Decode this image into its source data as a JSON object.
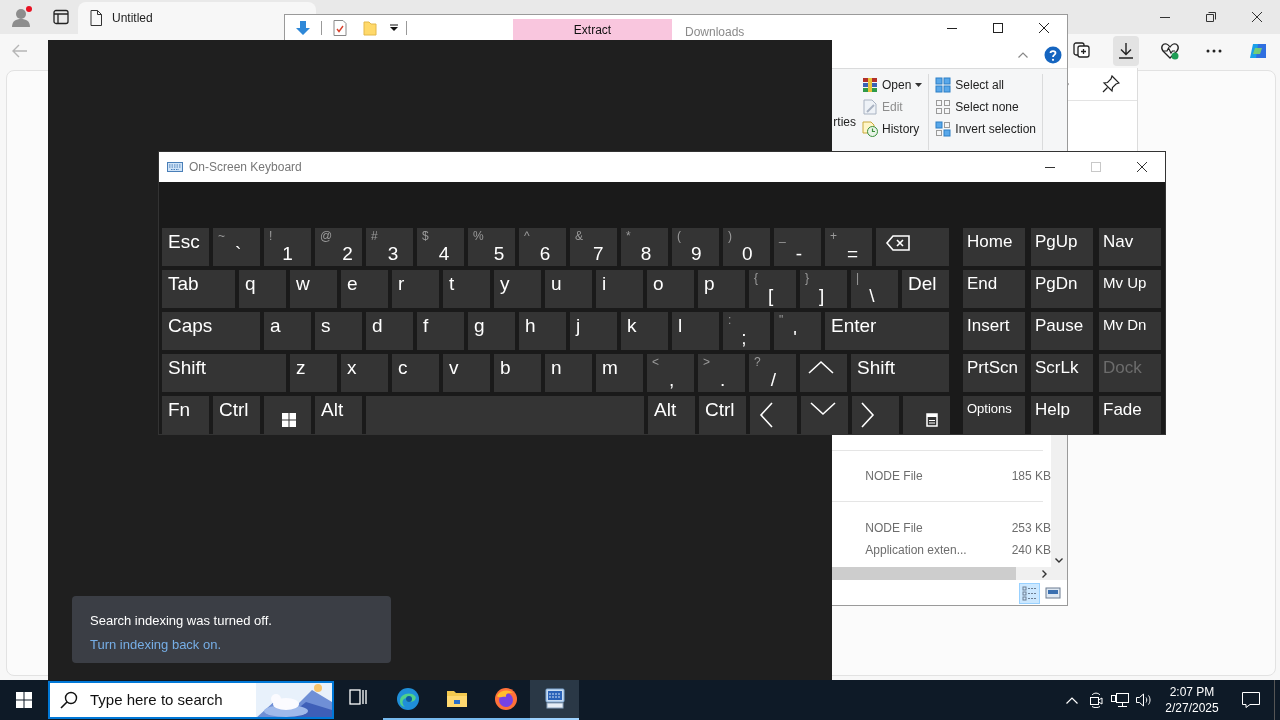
{
  "browser": {
    "tab_title": "Untitled",
    "toolbar_buttons": [
      {
        "selected": false
      },
      {
        "selected": true
      },
      {
        "selected": false
      },
      {
        "selected": false
      },
      {
        "selected": false
      }
    ]
  },
  "explorer": {
    "title": "Downloads",
    "context_tab": "Extract",
    "ribbon": {
      "partial_label": "rties",
      "open_items": [
        {
          "label": "Open",
          "has_menu": true,
          "disabled": false
        },
        {
          "label": "Edit",
          "has_menu": false,
          "disabled": true
        },
        {
          "label": "History",
          "has_menu": false,
          "disabled": false
        }
      ],
      "select_items": [
        "Select all",
        "Select none",
        "Invert selection"
      ]
    },
    "files": [
      {
        "type": "NODE File",
        "size": "185 KB"
      },
      {
        "type": "NODE File",
        "size": "253 KB"
      },
      {
        "type": "Application exten...",
        "size": "240 KB"
      }
    ],
    "views": [
      {
        "selected": true
      },
      {
        "selected": false
      }
    ]
  },
  "notification": {
    "message": "Search indexing was turned off.",
    "link": "Turn indexing back on."
  },
  "keyboard": {
    "title": "On-Screen Keyboard",
    "maximize_disabled": true,
    "rows": [
      {
        "keys": [
          {
            "kind": "char",
            "label": "Esc"
          },
          {
            "kind": "char",
            "label": "`",
            "shift": "~"
          },
          {
            "kind": "char",
            "label": "1",
            "shift": "!"
          },
          {
            "kind": "char",
            "label": "2",
            "shift": "@"
          },
          {
            "kind": "char",
            "label": "3",
            "shift": "#"
          },
          {
            "kind": "char",
            "label": "4",
            "shift": "$"
          },
          {
            "kind": "char",
            "label": "5",
            "shift": "%"
          },
          {
            "kind": "char",
            "label": "6",
            "shift": "^"
          },
          {
            "kind": "char",
            "label": "7",
            "shift": "&"
          },
          {
            "kind": "char",
            "label": "8",
            "shift": "*"
          },
          {
            "kind": "char",
            "label": "9",
            "shift": "("
          },
          {
            "kind": "char",
            "label": "0",
            "shift": ")"
          },
          {
            "kind": "char",
            "label": "-",
            "shift": "_"
          },
          {
            "kind": "char",
            "label": "=",
            "shift": "+"
          },
          {
            "kind": "icon"
          }
        ]
      },
      {
        "keys": [
          {
            "kind": "char",
            "label": "Tab"
          },
          {
            "kind": "char",
            "label": "q"
          },
          {
            "kind": "char",
            "label": "w"
          },
          {
            "kind": "char",
            "label": "e"
          },
          {
            "kind": "char",
            "label": "r"
          },
          {
            "kind": "char",
            "label": "t"
          },
          {
            "kind": "char",
            "label": "y"
          },
          {
            "kind": "char",
            "label": "u"
          },
          {
            "kind": "char",
            "label": "i"
          },
          {
            "kind": "char",
            "label": "o"
          },
          {
            "kind": "char",
            "label": "p"
          },
          {
            "kind": "char",
            "label": "[",
            "shift": "{"
          },
          {
            "kind": "char",
            "label": "]",
            "shift": "}"
          },
          {
            "kind": "char",
            "label": "\\",
            "shift": "|"
          },
          {
            "kind": "char",
            "label": "Del"
          }
        ]
      },
      {
        "keys": [
          {
            "kind": "char",
            "label": "Caps"
          },
          {
            "kind": "char",
            "label": "a"
          },
          {
            "kind": "char",
            "label": "s"
          },
          {
            "kind": "char",
            "label": "d"
          },
          {
            "kind": "char",
            "label": "f"
          },
          {
            "kind": "char",
            "label": "g"
          },
          {
            "kind": "char",
            "label": "h"
          },
          {
            "kind": "char",
            "label": "j"
          },
          {
            "kind": "char",
            "label": "k"
          },
          {
            "kind": "char",
            "label": "l"
          },
          {
            "kind": "char",
            "label": ";",
            "shift": ":"
          },
          {
            "kind": "char",
            "label": "'",
            "shift": "\""
          },
          {
            "kind": "char",
            "label": "Enter"
          }
        ]
      },
      {
        "keys": [
          {
            "kind": "char",
            "label": "Shift"
          },
          {
            "kind": "char",
            "label": "z"
          },
          {
            "kind": "char",
            "label": "x"
          },
          {
            "kind": "char",
            "label": "c"
          },
          {
            "kind": "char",
            "label": "v"
          },
          {
            "kind": "char",
            "label": "b"
          },
          {
            "kind": "char",
            "label": "n"
          },
          {
            "kind": "char",
            "label": "m"
          },
          {
            "kind": "char",
            "label": ",",
            "shift": "<"
          },
          {
            "kind": "char",
            "label": ".",
            "shift": ">"
          },
          {
            "kind": "char",
            "label": "/",
            "shift": "?"
          },
          {
            "kind": "icon"
          },
          {
            "kind": "char",
            "label": "Shift"
          }
        ]
      },
      {
        "keys": [
          {
            "kind": "char",
            "label": "Fn"
          },
          {
            "kind": "char",
            "label": "Ctrl"
          },
          {
            "kind": "icon"
          },
          {
            "kind": "char",
            "label": "Alt"
          },
          {
            "kind": "space"
          },
          {
            "kind": "char",
            "label": "Alt"
          },
          {
            "kind": "char",
            "label": "Ctrl"
          },
          {
            "kind": "icon"
          },
          {
            "kind": "icon"
          },
          {
            "kind": "icon"
          },
          {
            "kind": "icon"
          }
        ]
      }
    ],
    "nav_rows": [
      {
        "keys": [
          {
            "label": "Home",
            "disabled": false
          },
          {
            "label": "PgUp",
            "disabled": false
          },
          {
            "label": "Nav",
            "disabled": false
          }
        ]
      },
      {
        "keys": [
          {
            "label": "End",
            "disabled": false
          },
          {
            "label": "PgDn",
            "disabled": false
          },
          {
            "label": "Mv Up",
            "disabled": false
          }
        ]
      },
      {
        "keys": [
          {
            "label": "Insert",
            "disabled": false
          },
          {
            "label": "Pause",
            "disabled": false
          },
          {
            "label": "Mv Dn",
            "disabled": false
          }
        ]
      },
      {
        "keys": [
          {
            "label": "PrtScn",
            "disabled": false
          },
          {
            "label": "ScrLk",
            "disabled": false
          },
          {
            "label": "Dock",
            "disabled": true
          }
        ]
      },
      {
        "keys": [
          {
            "label": "Options",
            "disabled": false
          },
          {
            "label": "Help",
            "disabled": false
          },
          {
            "label": "Fade",
            "disabled": false
          }
        ]
      }
    ]
  },
  "taskbar": {
    "search_placeholder": "Type here to search",
    "apps": [
      {
        "running": false,
        "selected": false
      },
      {
        "running": true,
        "selected": false
      },
      {
        "running": true,
        "selected": false
      },
      {
        "running": true,
        "selected": false
      },
      {
        "running": true,
        "selected": true
      }
    ],
    "time": "2:07 PM",
    "date": "2/27/2025"
  }
}
